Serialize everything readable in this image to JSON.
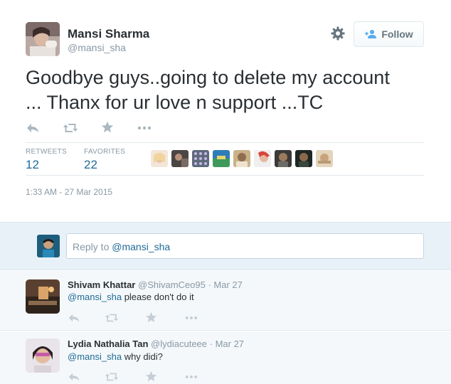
{
  "tweet": {
    "author_name": "Mansi Sharma",
    "author_handle": "@mansi_sha",
    "follow_label": "Follow",
    "text_line1": "Goodbye guys..going to delete my account",
    "text_line2": "... Thanx for ur love n support ...TC",
    "stats": {
      "retweets_label": "RETWEETS",
      "retweets_value": "12",
      "favorites_label": "FAVORITES",
      "favorites_value": "22"
    },
    "timestamp": "1:33 AM - 27 Mar 2015"
  },
  "reply_box": {
    "prefix": "Reply to ",
    "mention": "@mansi_sha"
  },
  "replies": [
    {
      "name": "Shivam Khattar",
      "handle": "@ShivamCeo95",
      "sep": " · ",
      "date": "Mar 27",
      "mention": "@mansi_sha",
      "text": " please don't do it"
    },
    {
      "name": "Lydia Nathalia Tan",
      "handle": "@lydiacuteee",
      "sep": " · ",
      "date": "Mar 27",
      "mention": "@mansi_sha",
      "text": " why didi?"
    }
  ],
  "colors": {
    "link": "#1f6b97",
    "muted": "#8899a6",
    "text": "#292f33",
    "reply_bg": "#f5f8fa",
    "reply_box_bg": "#e8f1f7"
  },
  "icons": [
    "gear-icon",
    "follow-person-plus-icon",
    "reply-icon",
    "retweet-icon",
    "favorite-star-icon",
    "more-dots-icon"
  ]
}
